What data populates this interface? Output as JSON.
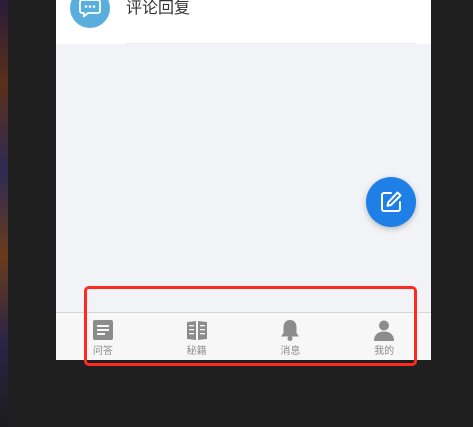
{
  "reply_item": {
    "label": "评论回复",
    "icon": "chat-bubble-icon",
    "icon_color": "#5aaedd"
  },
  "fab": {
    "icon": "compose-icon",
    "color": "#1e7fe6"
  },
  "tabbar": {
    "items": [
      {
        "label": "问答",
        "icon": "qa-list-icon"
      },
      {
        "label": "秘籍",
        "icon": "book-icon"
      },
      {
        "label": "消息",
        "icon": "bell-icon"
      },
      {
        "label": "我的",
        "icon": "user-icon"
      }
    ],
    "icon_color": "#8c8c8c"
  },
  "annotation": {
    "color": "#ff2a1f"
  }
}
